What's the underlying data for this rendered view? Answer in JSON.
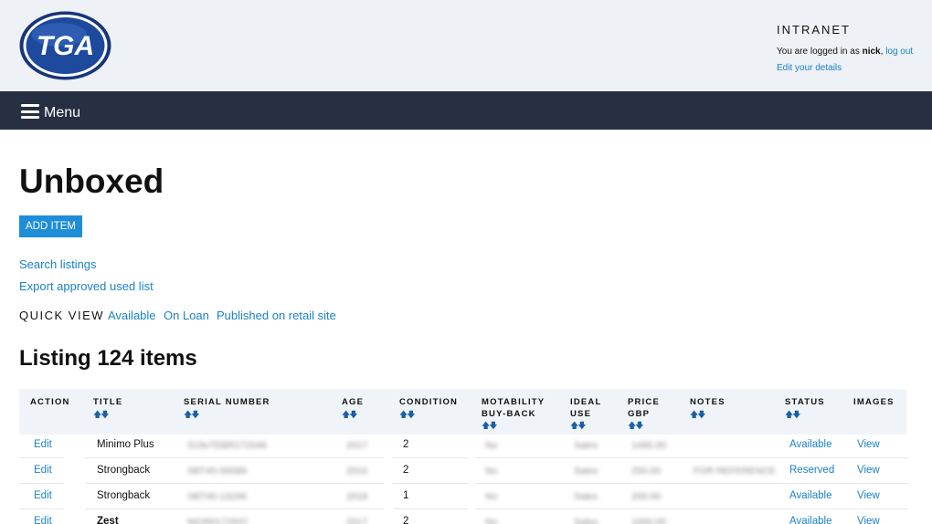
{
  "header": {
    "logo_text": "TGA",
    "site_label": "INTRANET",
    "login_prefix": "You are logged in as",
    "username": "nick",
    "logout_link": "log out",
    "edit_details_link": "Edit your details"
  },
  "nav": {
    "menu_label": "Menu"
  },
  "page": {
    "title": "Unboxed",
    "add_button": "ADD ITEM",
    "search_link": "Search listings",
    "export_link": "Export approved used list",
    "quick_view_label": "QUICK VIEW",
    "quick_view_links": [
      "Available",
      "On Loan",
      "Published on retail site"
    ],
    "listing_heading": "Listing 124 items"
  },
  "table": {
    "columns": [
      {
        "line1": "ACTION",
        "line2": ""
      },
      {
        "line1": "TITLE",
        "line2": ""
      },
      {
        "line1": "SERIAL NUMBER",
        "line2": ""
      },
      {
        "line1": "AGE",
        "line2": ""
      },
      {
        "line1": "CONDITION",
        "line2": ""
      },
      {
        "line1": "MOTABILITY",
        "line2": "BUY-BACK"
      },
      {
        "line1": "IDEAL",
        "line2": "USE"
      },
      {
        "line1": "PRICE",
        "line2": "GBP"
      },
      {
        "line1": "NOTES",
        "line2": ""
      },
      {
        "line1": "STATUS",
        "line2": ""
      },
      {
        "line1": "IMAGES",
        "line2": ""
      }
    ],
    "sort_arrows": "🡅🡇",
    "rows": [
      {
        "action": "Edit",
        "title": "Minimo Plus",
        "serial": "S19vTEBR172046",
        "age": "2017",
        "condition": "2",
        "motability": "No",
        "ideal_use": "Sales",
        "price": "1495.00",
        "notes": "",
        "status": "Available",
        "images": "View"
      },
      {
        "action": "Edit",
        "title": "Strongback",
        "serial": "SBT45-00089",
        "age": "2016",
        "condition": "2",
        "motability": "No",
        "ideal_use": "Sales",
        "price": "250.00",
        "notes": "FOR REFERENCE",
        "status": "Reserved",
        "images": "View"
      },
      {
        "action": "Edit",
        "title": "Strongback",
        "serial": "SBT45-13206",
        "age": "2018",
        "condition": "1",
        "motability": "No",
        "ideal_use": "Sales",
        "price": "250.00",
        "notes": "",
        "status": "Available",
        "images": "View"
      },
      {
        "action": "Edit",
        "title": "Zest",
        "serial": "WOR0172937",
        "age": "2017",
        "condition": "2",
        "motability": "No",
        "ideal_use": "Sales",
        "price": "1000.00",
        "notes": "",
        "status": "Available",
        "images": "View"
      }
    ]
  },
  "colors": {
    "accent": "#1f8ed8",
    "link": "#1a82c8",
    "navbar": "#272f42",
    "header_bg": "#eef1f5",
    "logo_blue": "#1d4a9c"
  }
}
